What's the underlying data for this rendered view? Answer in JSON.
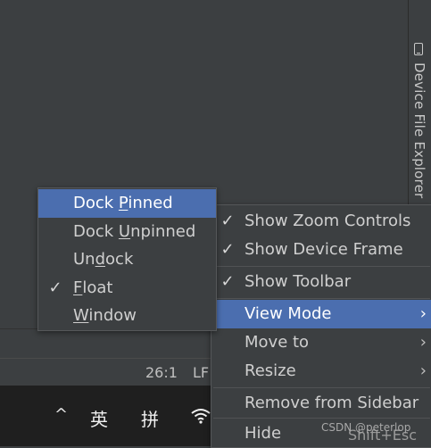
{
  "sidebar_tab": {
    "label": "Device File Explorer",
    "icon": "device-icon"
  },
  "status": {
    "position": "26:1",
    "line_sep": "LF"
  },
  "taskbar": {
    "chevron": "^",
    "ime_1": "英",
    "ime_2": "拼",
    "wifi_icon": "wifi-icon"
  },
  "context_menu": {
    "show_zoom_controls": "Show Zoom Controls",
    "show_device_frame": "Show Device Frame",
    "show_toolbar": "Show Toolbar",
    "view_mode": "View Mode",
    "move_to": "Move to",
    "resize": "Resize",
    "remove_from_sidebar": "Remove from Sidebar",
    "hide": "Hide",
    "hide_shortcut": "Shift+Esc"
  },
  "submenu": {
    "dock_pinned_pre": "Dock ",
    "dock_pinned_u": "P",
    "dock_pinned_post": "inned",
    "dock_unpinned_pre": "Dock ",
    "dock_unpinned_u": "U",
    "dock_unpinned_post": "npinned",
    "undock_pre": "Un",
    "undock_u": "d",
    "undock_post": "ock",
    "float_u": "F",
    "float_post": "loat",
    "window_u": "W",
    "window_post": "indow"
  },
  "check_glyph": "✓",
  "arrow_glyph": "›",
  "watermark": "CSDN @peterlop",
  "colors": {
    "bg": "#3c3f41",
    "selection": "#4b6eaf",
    "taskbar": "#1f1f1f"
  }
}
